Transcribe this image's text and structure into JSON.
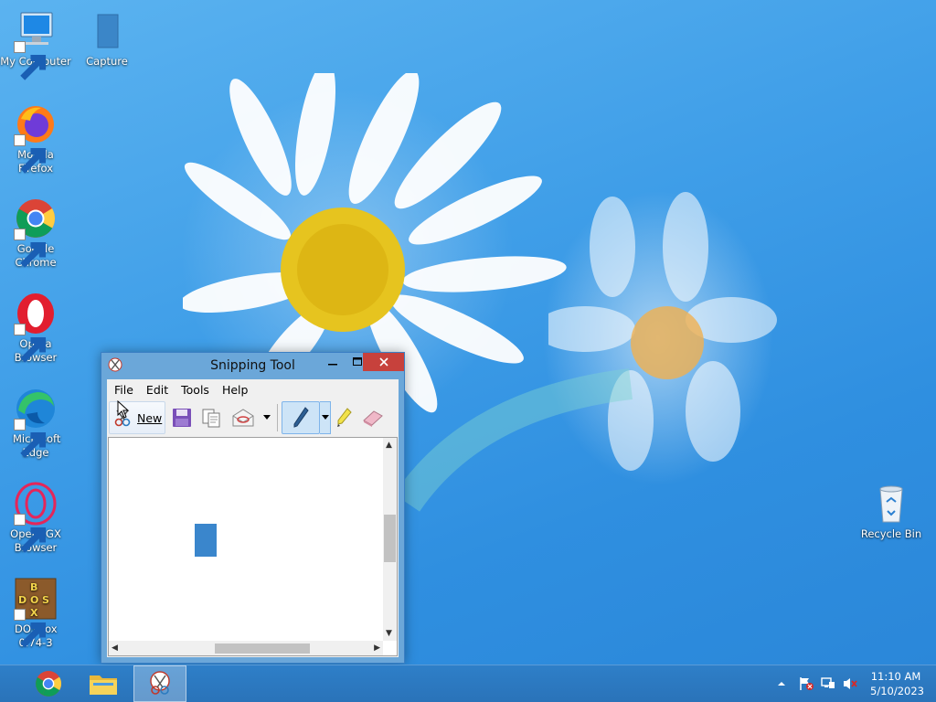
{
  "desktop": {
    "icons": [
      {
        "label": "My Computer",
        "icon": "computer-icon"
      },
      {
        "label": "Capture",
        "icon": "file-icon"
      },
      {
        "label": "Mozilla Firefox",
        "icon": "firefox-icon"
      },
      {
        "label": "Google Chrome",
        "icon": "chrome-icon"
      },
      {
        "label": "Opera Browser",
        "icon": "opera-icon"
      },
      {
        "label": "Microsoft Edge",
        "icon": "edge-icon"
      },
      {
        "label": "Opera GX Browser",
        "icon": "opera-gx-icon"
      },
      {
        "label": "DOSBox 0.74-3",
        "icon": "dosbox-icon"
      },
      {
        "label": "Recycle Bin",
        "icon": "recycle-bin-icon"
      }
    ]
  },
  "snipping_tool": {
    "title": "Snipping Tool",
    "menu": [
      "File",
      "Edit",
      "Tools",
      "Help"
    ],
    "toolbar": {
      "new_label": "New",
      "tools": [
        "new-snip",
        "save",
        "copy",
        "send-snip",
        "pen",
        "highlighter",
        "eraser"
      ]
    }
  },
  "taskbar": {
    "apps": [
      "chrome-icon",
      "file-explorer-icon",
      "snipping-tool-icon"
    ],
    "active_app": "snipping-tool-icon",
    "clock": {
      "time": "11:10 AM",
      "date": "5/10/2023"
    }
  },
  "colors": {
    "accent": "#2a73b9",
    "close_button": "#c7413c"
  }
}
